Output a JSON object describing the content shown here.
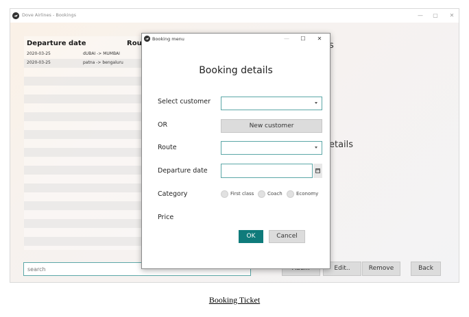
{
  "main_window": {
    "title": "Dove Airlines - Bookings",
    "controls": {
      "minimize": "—",
      "maximize": "▢",
      "close": "✕"
    },
    "table": {
      "columns": [
        "Departure date",
        "Rout"
      ],
      "rows": [
        {
          "date": "2020-03-25",
          "route": "dUBAI -> MUMBAI"
        },
        {
          "date": "2020-03-25",
          "route": "patna -> bengaluru"
        }
      ]
    },
    "partial_title_top": "s",
    "partial_details": "etails",
    "search": {
      "placeholder": "search"
    },
    "buttons": {
      "add": "Add...",
      "edit": "Edit..",
      "remove": "Remove",
      "back": "Back"
    }
  },
  "dialog": {
    "title": "Booking menu",
    "controls": {
      "minimize": "—",
      "maximize": "☐",
      "close": "✕"
    },
    "heading": "Booking details",
    "labels": {
      "select_customer": "Select customer",
      "or": "OR",
      "route": "Route",
      "departure_date": "Departure date",
      "category": "Category",
      "price": "Price"
    },
    "new_customer_button": "New customer",
    "categories": [
      "First class",
      "Coach",
      "Economy"
    ],
    "ok_button": "OK",
    "cancel_button": "Cancel"
  },
  "caption": "Booking Ticket",
  "colors": {
    "accent": "#0f7b7b",
    "field_border": "#5aa6a6",
    "button_bg": "#dcdcdc"
  },
  "icons": [
    "app-icon",
    "minimize-icon",
    "maximize-icon",
    "close-icon",
    "dropdown-caret-icon",
    "calendar-icon",
    "radio-button"
  ]
}
